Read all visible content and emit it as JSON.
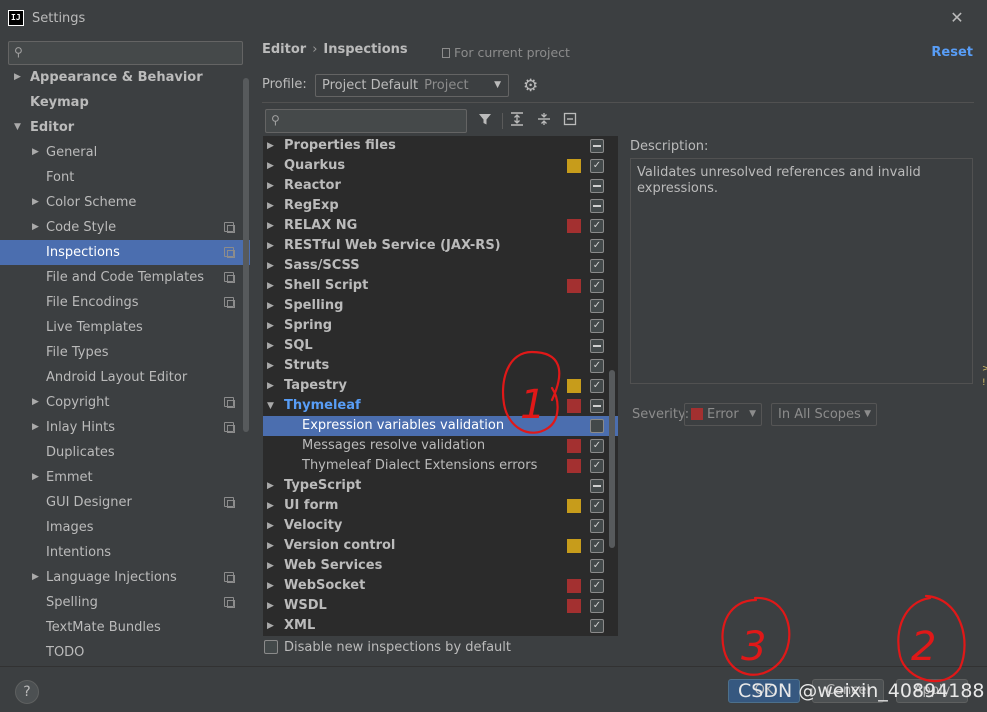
{
  "window": {
    "title": "Settings",
    "app_icon_text": "IJ"
  },
  "left_search": {
    "placeholder": ""
  },
  "nav": {
    "items": [
      {
        "label": "Appearance & Behavior",
        "arrow": "▶",
        "level": 0,
        "bold": true
      },
      {
        "label": "Keymap",
        "arrow": "",
        "level": 0,
        "bold": true
      },
      {
        "label": "Editor",
        "arrow": "▼",
        "level": 0,
        "bold": true
      },
      {
        "label": "General",
        "arrow": "▶",
        "level": 1
      },
      {
        "label": "Font",
        "arrow": "",
        "level": 1
      },
      {
        "label": "Color Scheme",
        "arrow": "▶",
        "level": 1
      },
      {
        "label": "Code Style",
        "arrow": "▶",
        "level": 1,
        "project_icon": true
      },
      {
        "label": "Inspections",
        "arrow": "",
        "level": 1,
        "project_icon": true,
        "selected": true
      },
      {
        "label": "File and Code Templates",
        "arrow": "",
        "level": 1,
        "project_icon": true
      },
      {
        "label": "File Encodings",
        "arrow": "",
        "level": 1,
        "project_icon": true
      },
      {
        "label": "Live Templates",
        "arrow": "",
        "level": 1
      },
      {
        "label": "File Types",
        "arrow": "",
        "level": 1
      },
      {
        "label": "Android Layout Editor",
        "arrow": "",
        "level": 1
      },
      {
        "label": "Copyright",
        "arrow": "▶",
        "level": 1,
        "project_icon": true
      },
      {
        "label": "Inlay Hints",
        "arrow": "▶",
        "level": 1,
        "project_icon": true
      },
      {
        "label": "Duplicates",
        "arrow": "",
        "level": 1
      },
      {
        "label": "Emmet",
        "arrow": "▶",
        "level": 1
      },
      {
        "label": "GUI Designer",
        "arrow": "",
        "level": 1,
        "project_icon": true
      },
      {
        "label": "Images",
        "arrow": "",
        "level": 1
      },
      {
        "label": "Intentions",
        "arrow": "",
        "level": 1
      },
      {
        "label": "Language Injections",
        "arrow": "▶",
        "level": 1,
        "project_icon": true
      },
      {
        "label": "Spelling",
        "arrow": "",
        "level": 1,
        "project_icon": true
      },
      {
        "label": "TextMate Bundles",
        "arrow": "",
        "level": 1
      },
      {
        "label": "TODO",
        "arrow": "",
        "level": 1
      }
    ]
  },
  "header": {
    "breadcrumb_root": "Editor",
    "breadcrumb_sep": "›",
    "breadcrumb_current": "Inspections",
    "scope_note": "For current project",
    "reset_label": "Reset"
  },
  "profile": {
    "label": "Profile:",
    "value": "Project Default",
    "secondary": "Project"
  },
  "icons": {
    "gear": "gear-icon",
    "filter": "filter-icon",
    "expand_all": "expand-all-icon",
    "collapse_all": "collapse-all-icon",
    "reset_defaults": "reset-to-default-icon",
    "search": "search-icon",
    "help": "help-icon",
    "close": "close-icon"
  },
  "inspection_search": {
    "placeholder": ""
  },
  "colors": {
    "error": "#a33030",
    "warning": "#c79c1b",
    "selection": "#4b6eaf",
    "link": "#589df6"
  },
  "tree": {
    "rows": [
      {
        "label": "Properties files",
        "arrow": "▶",
        "severity": "",
        "check": "partial"
      },
      {
        "label": "Quarkus",
        "arrow": "▶",
        "severity": "warning",
        "check": "checked"
      },
      {
        "label": "Reactor",
        "arrow": "▶",
        "severity": "",
        "check": "partial"
      },
      {
        "label": "RegExp",
        "arrow": "▶",
        "severity": "",
        "check": "partial"
      },
      {
        "label": "RELAX NG",
        "arrow": "▶",
        "severity": "error",
        "check": "checked"
      },
      {
        "label": "RESTful Web Service (JAX-RS)",
        "arrow": "▶",
        "severity": "",
        "check": "checked"
      },
      {
        "label": "Sass/SCSS",
        "arrow": "▶",
        "severity": "",
        "check": "checked"
      },
      {
        "label": "Shell Script",
        "arrow": "▶",
        "severity": "error",
        "check": "checked"
      },
      {
        "label": "Spelling",
        "arrow": "▶",
        "severity": "",
        "check": "checked"
      },
      {
        "label": "Spring",
        "arrow": "▶",
        "severity": "",
        "check": "checked"
      },
      {
        "label": "SQL",
        "arrow": "▶",
        "severity": "",
        "check": "partial"
      },
      {
        "label": "Struts",
        "arrow": "▶",
        "severity": "",
        "check": "checked"
      },
      {
        "label": "Tapestry",
        "arrow": "▶",
        "severity": "warning",
        "check": "checked"
      },
      {
        "label": "Thymeleaf",
        "arrow": "▼",
        "severity": "error",
        "check": "partial",
        "highlight": true
      },
      {
        "label": "Expression variables validation",
        "arrow": "",
        "severity": "",
        "check": "unchecked",
        "child": true,
        "selected": true
      },
      {
        "label": "Messages resolve validation",
        "arrow": "",
        "severity": "error",
        "check": "checked",
        "child": true
      },
      {
        "label": "Thymeleaf Dialect Extensions errors",
        "arrow": "",
        "severity": "error",
        "check": "checked",
        "child": true
      },
      {
        "label": "TypeScript",
        "arrow": "▶",
        "severity": "",
        "check": "partial"
      },
      {
        "label": "UI form",
        "arrow": "▶",
        "severity": "warning",
        "check": "checked"
      },
      {
        "label": "Velocity",
        "arrow": "▶",
        "severity": "",
        "check": "checked"
      },
      {
        "label": "Version control",
        "arrow": "▶",
        "severity": "warning",
        "check": "checked"
      },
      {
        "label": "Web Services",
        "arrow": "▶",
        "severity": "",
        "check": "checked"
      },
      {
        "label": "WebSocket",
        "arrow": "▶",
        "severity": "error",
        "check": "checked"
      },
      {
        "label": "WSDL",
        "arrow": "▶",
        "severity": "error",
        "check": "checked"
      },
      {
        "label": "XML",
        "arrow": "▶",
        "severity": "",
        "check": "checked"
      }
    ]
  },
  "disable_new": {
    "label": "Disable new inspections by default",
    "checked": false
  },
  "description": {
    "label": "Description:",
    "text": "Validates unresolved references and invalid expressions."
  },
  "severity": {
    "label": "Severity:",
    "value": "Error",
    "scope": "In All Scopes"
  },
  "footer": {
    "help": "?",
    "ok": "OK",
    "cancel": "Cancel",
    "apply": "Apply"
  },
  "annotations": {
    "a1": "1",
    "a2": "2",
    "a3": "3"
  },
  "watermark": "CSDN @weixin_40894188"
}
